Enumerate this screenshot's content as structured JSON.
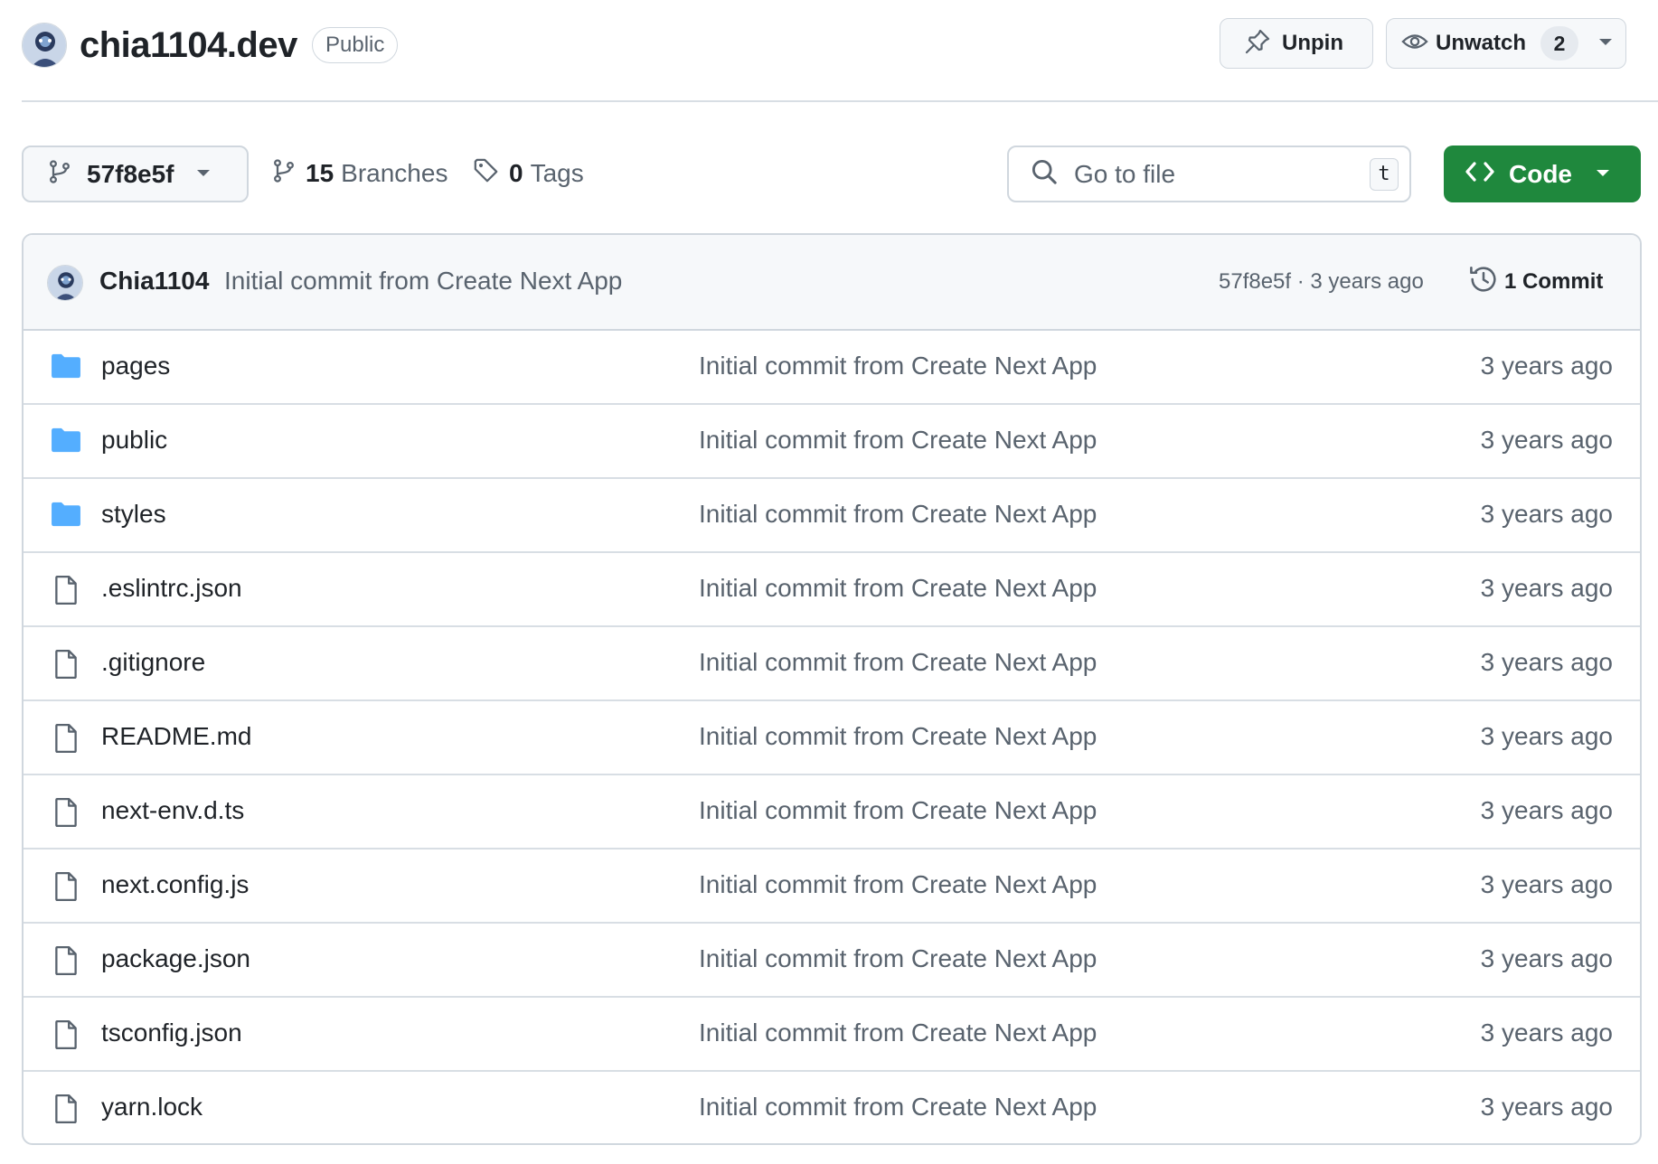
{
  "repo": {
    "name": "chia1104.dev",
    "visibility": "Public",
    "unpin_label": "Unpin",
    "unwatch_label": "Unwatch",
    "watchers_count": "2"
  },
  "toolbar": {
    "branch": "57f8e5f",
    "branches_count": "15",
    "branches_label": "Branches",
    "tags_count": "0",
    "tags_label": "Tags",
    "search_placeholder": "Go to file",
    "search_shortcut": "t",
    "code_label": "Code"
  },
  "latest_commit": {
    "author": "Chia1104",
    "message": "Initial commit from Create Next App",
    "meta": "57f8e5f · 3 years ago",
    "commits_label": "1 Commit"
  },
  "files": [
    {
      "name": "pages",
      "type": "folder",
      "message": "Initial commit from Create Next App",
      "age": "3 years ago"
    },
    {
      "name": "public",
      "type": "folder",
      "message": "Initial commit from Create Next App",
      "age": "3 years ago"
    },
    {
      "name": "styles",
      "type": "folder",
      "message": "Initial commit from Create Next App",
      "age": "3 years ago"
    },
    {
      "name": ".eslintrc.json",
      "type": "file",
      "message": "Initial commit from Create Next App",
      "age": "3 years ago"
    },
    {
      "name": ".gitignore",
      "type": "file",
      "message": "Initial commit from Create Next App",
      "age": "3 years ago"
    },
    {
      "name": "README.md",
      "type": "file",
      "message": "Initial commit from Create Next App",
      "age": "3 years ago"
    },
    {
      "name": "next-env.d.ts",
      "type": "file",
      "message": "Initial commit from Create Next App",
      "age": "3 years ago"
    },
    {
      "name": "next.config.js",
      "type": "file",
      "message": "Initial commit from Create Next App",
      "age": "3 years ago"
    },
    {
      "name": "package.json",
      "type": "file",
      "message": "Initial commit from Create Next App",
      "age": "3 years ago"
    },
    {
      "name": "tsconfig.json",
      "type": "file",
      "message": "Initial commit from Create Next App",
      "age": "3 years ago"
    },
    {
      "name": "yarn.lock",
      "type": "file",
      "message": "Initial commit from Create Next App",
      "age": "3 years ago"
    }
  ],
  "colors": {
    "folder": "#54aeff",
    "code_button": "#1f883d",
    "muted_text": "#59636e",
    "border": "#d0d7de"
  }
}
